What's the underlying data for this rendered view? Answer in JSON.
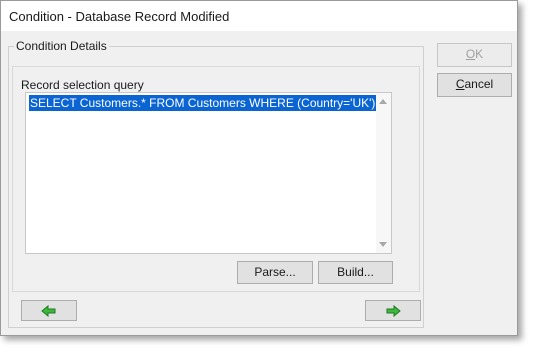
{
  "window": {
    "title": "Condition - Database Record Modified"
  },
  "group": {
    "label": "Condition Details"
  },
  "query": {
    "label": "Record selection query",
    "text": "SELECT Customers.* FROM Customers WHERE (Country='UK')",
    "selected": true
  },
  "buttons": {
    "ok_label": "OK",
    "cancel_label": "Cancel",
    "parse_label": "Parse...",
    "build_label": "Build..."
  },
  "nav": {
    "back_icon": "green-arrow-left-icon",
    "next_icon": "green-arrow-right-icon"
  },
  "colors": {
    "selection": "#0a64d2",
    "arrow_fill": "#3cb83c"
  }
}
